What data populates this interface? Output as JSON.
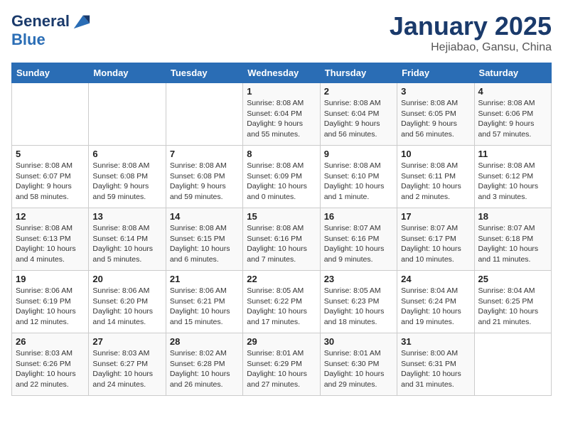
{
  "header": {
    "logo_line1": "General",
    "logo_line2": "Blue",
    "title": "January 2025",
    "subtitle": "Hejiabao, Gansu, China"
  },
  "days_of_week": [
    "Sunday",
    "Monday",
    "Tuesday",
    "Wednesday",
    "Thursday",
    "Friday",
    "Saturday"
  ],
  "weeks": [
    [
      {
        "num": "",
        "info": ""
      },
      {
        "num": "",
        "info": ""
      },
      {
        "num": "",
        "info": ""
      },
      {
        "num": "1",
        "info": "Sunrise: 8:08 AM\nSunset: 6:04 PM\nDaylight: 9 hours\nand 55 minutes."
      },
      {
        "num": "2",
        "info": "Sunrise: 8:08 AM\nSunset: 6:04 PM\nDaylight: 9 hours\nand 56 minutes."
      },
      {
        "num": "3",
        "info": "Sunrise: 8:08 AM\nSunset: 6:05 PM\nDaylight: 9 hours\nand 56 minutes."
      },
      {
        "num": "4",
        "info": "Sunrise: 8:08 AM\nSunset: 6:06 PM\nDaylight: 9 hours\nand 57 minutes."
      }
    ],
    [
      {
        "num": "5",
        "info": "Sunrise: 8:08 AM\nSunset: 6:07 PM\nDaylight: 9 hours\nand 58 minutes."
      },
      {
        "num": "6",
        "info": "Sunrise: 8:08 AM\nSunset: 6:08 PM\nDaylight: 9 hours\nand 59 minutes."
      },
      {
        "num": "7",
        "info": "Sunrise: 8:08 AM\nSunset: 6:08 PM\nDaylight: 9 hours\nand 59 minutes."
      },
      {
        "num": "8",
        "info": "Sunrise: 8:08 AM\nSunset: 6:09 PM\nDaylight: 10 hours\nand 0 minutes."
      },
      {
        "num": "9",
        "info": "Sunrise: 8:08 AM\nSunset: 6:10 PM\nDaylight: 10 hours\nand 1 minute."
      },
      {
        "num": "10",
        "info": "Sunrise: 8:08 AM\nSunset: 6:11 PM\nDaylight: 10 hours\nand 2 minutes."
      },
      {
        "num": "11",
        "info": "Sunrise: 8:08 AM\nSunset: 6:12 PM\nDaylight: 10 hours\nand 3 minutes."
      }
    ],
    [
      {
        "num": "12",
        "info": "Sunrise: 8:08 AM\nSunset: 6:13 PM\nDaylight: 10 hours\nand 4 minutes."
      },
      {
        "num": "13",
        "info": "Sunrise: 8:08 AM\nSunset: 6:14 PM\nDaylight: 10 hours\nand 5 minutes."
      },
      {
        "num": "14",
        "info": "Sunrise: 8:08 AM\nSunset: 6:15 PM\nDaylight: 10 hours\nand 6 minutes."
      },
      {
        "num": "15",
        "info": "Sunrise: 8:08 AM\nSunset: 6:16 PM\nDaylight: 10 hours\nand 7 minutes."
      },
      {
        "num": "16",
        "info": "Sunrise: 8:07 AM\nSunset: 6:16 PM\nDaylight: 10 hours\nand 9 minutes."
      },
      {
        "num": "17",
        "info": "Sunrise: 8:07 AM\nSunset: 6:17 PM\nDaylight: 10 hours\nand 10 minutes."
      },
      {
        "num": "18",
        "info": "Sunrise: 8:07 AM\nSunset: 6:18 PM\nDaylight: 10 hours\nand 11 minutes."
      }
    ],
    [
      {
        "num": "19",
        "info": "Sunrise: 8:06 AM\nSunset: 6:19 PM\nDaylight: 10 hours\nand 12 minutes."
      },
      {
        "num": "20",
        "info": "Sunrise: 8:06 AM\nSunset: 6:20 PM\nDaylight: 10 hours\nand 14 minutes."
      },
      {
        "num": "21",
        "info": "Sunrise: 8:06 AM\nSunset: 6:21 PM\nDaylight: 10 hours\nand 15 minutes."
      },
      {
        "num": "22",
        "info": "Sunrise: 8:05 AM\nSunset: 6:22 PM\nDaylight: 10 hours\nand 17 minutes."
      },
      {
        "num": "23",
        "info": "Sunrise: 8:05 AM\nSunset: 6:23 PM\nDaylight: 10 hours\nand 18 minutes."
      },
      {
        "num": "24",
        "info": "Sunrise: 8:04 AM\nSunset: 6:24 PM\nDaylight: 10 hours\nand 19 minutes."
      },
      {
        "num": "25",
        "info": "Sunrise: 8:04 AM\nSunset: 6:25 PM\nDaylight: 10 hours\nand 21 minutes."
      }
    ],
    [
      {
        "num": "26",
        "info": "Sunrise: 8:03 AM\nSunset: 6:26 PM\nDaylight: 10 hours\nand 22 minutes."
      },
      {
        "num": "27",
        "info": "Sunrise: 8:03 AM\nSunset: 6:27 PM\nDaylight: 10 hours\nand 24 minutes."
      },
      {
        "num": "28",
        "info": "Sunrise: 8:02 AM\nSunset: 6:28 PM\nDaylight: 10 hours\nand 26 minutes."
      },
      {
        "num": "29",
        "info": "Sunrise: 8:01 AM\nSunset: 6:29 PM\nDaylight: 10 hours\nand 27 minutes."
      },
      {
        "num": "30",
        "info": "Sunrise: 8:01 AM\nSunset: 6:30 PM\nDaylight: 10 hours\nand 29 minutes."
      },
      {
        "num": "31",
        "info": "Sunrise: 8:00 AM\nSunset: 6:31 PM\nDaylight: 10 hours\nand 31 minutes."
      },
      {
        "num": "",
        "info": ""
      }
    ]
  ]
}
